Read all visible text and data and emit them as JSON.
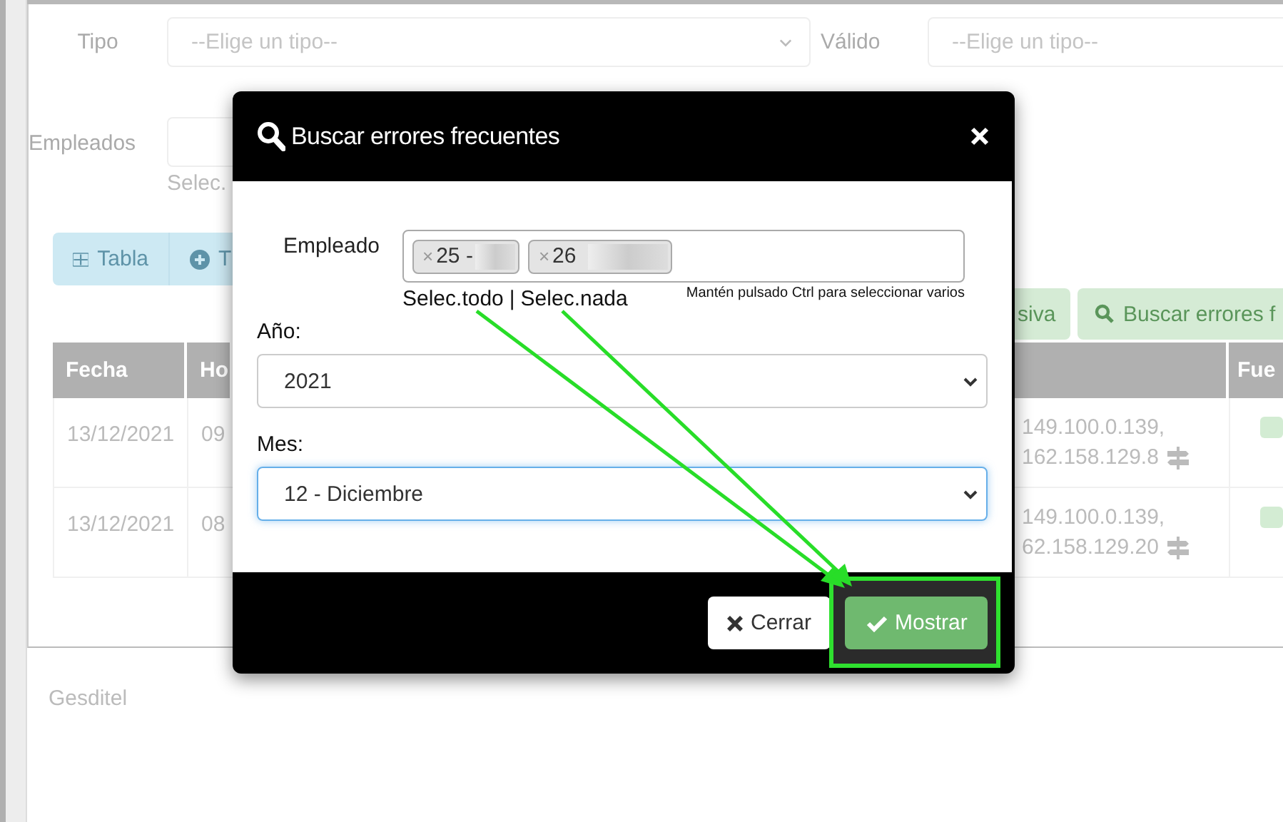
{
  "page": {
    "filters": [
      {
        "label": "Tipo",
        "placeholder": "--Elige un tipo--"
      },
      {
        "label": "Válido",
        "placeholder": "--Elige un tipo--"
      }
    ],
    "employees": {
      "label": "Empleados",
      "hint": "Selec."
    },
    "view_buttons": [
      "Tabla",
      "T"
    ],
    "action_buttons": [
      "siva",
      "Buscar errores f"
    ],
    "table": {
      "columns": [
        "Fecha",
        "Ho",
        "Fue"
      ],
      "rows": [
        {
          "date": "13/12/2021",
          "time": "09",
          "ips": [
            "149.100.0.139,",
            "162.158.129.8"
          ]
        },
        {
          "date": "13/12/2021",
          "time": "08",
          "ips": [
            "149.100.0.139,",
            "62.158.129.20"
          ]
        }
      ]
    },
    "footer": "Gesditel"
  },
  "dialog": {
    "title": "Buscar errores frecuentes",
    "employee": {
      "label": "Empleado",
      "chips": [
        {
          "remove": "×",
          "text": "25 -"
        },
        {
          "remove": "×",
          "text": "26"
        }
      ],
      "select_all": "Selec.todo",
      "separator": "|",
      "select_none": "Selec.nada",
      "help": "Mantén pulsado Ctrl para seleccionar varios"
    },
    "year": {
      "label": "Año:",
      "value": "2021",
      "focused": false
    },
    "month": {
      "label": "Mes:",
      "value": "12 - Diciembre",
      "focused": true
    },
    "buttons": [
      {
        "kind": "close",
        "label": "Cerrar",
        "highlighted": false
      },
      {
        "kind": "primary",
        "label": "Mostrar",
        "highlighted": true
      }
    ]
  }
}
